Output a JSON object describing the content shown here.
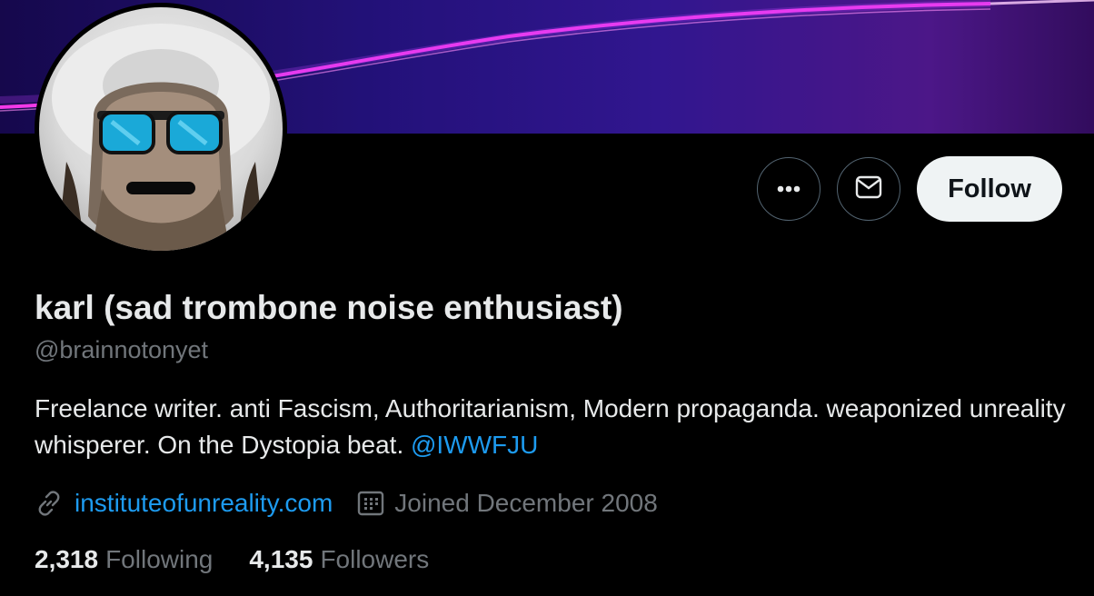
{
  "profile": {
    "display_name": "karl (sad trombone noise enthusiast)",
    "handle": "@brainnotonyet",
    "bio_text": "Freelance writer. anti Fascism, Authoritarianism, Modern propaganda. weaponized unreality whisperer. On the Dystopia beat. ",
    "bio_mention": "@IWWFJU",
    "website": "instituteofunreality.com",
    "joined": "Joined December 2008"
  },
  "actions": {
    "more_icon": "more-horizontal-icon",
    "message_icon": "envelope-icon",
    "follow_label": "Follow"
  },
  "stats": {
    "following_count": "2,318",
    "following_label": "Following",
    "followers_count": "4,135",
    "followers_label": "Followers"
  },
  "icons": {
    "website": "link-icon",
    "joined": "calendar-icon"
  },
  "colors": {
    "background": "#000000",
    "accent": "#1d9bf0",
    "muted_text": "#71767b",
    "primary_text": "#e7e9ea",
    "follow_button_bg": "#eff3f4",
    "banner_neon": "#ff3cf0"
  }
}
